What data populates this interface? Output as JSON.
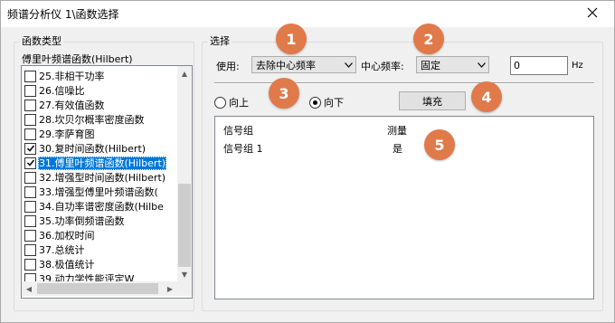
{
  "window": {
    "title": "频谱分析仪 1\\函数选择",
    "close_icon": "close-icon"
  },
  "function_type": {
    "legend": "函数类型",
    "current": "傅里叶频谱函数(Hilbert)",
    "items": [
      {
        "label": "25.非相干功率",
        "checked": false,
        "selected": false
      },
      {
        "label": "26.信噪比",
        "checked": false,
        "selected": false
      },
      {
        "label": "27.有效值函数",
        "checked": false,
        "selected": false
      },
      {
        "label": "28.坎贝尔概率密度函数",
        "checked": false,
        "selected": false
      },
      {
        "label": "29.李萨育图",
        "checked": false,
        "selected": false
      },
      {
        "label": "30.复时间函数(Hilbert)",
        "checked": true,
        "selected": false
      },
      {
        "label": "31.傅里叶频谱函数(Hilbert)",
        "checked": true,
        "selected": true
      },
      {
        "label": "32.增强型时间函数(Hilbert)",
        "checked": false,
        "selected": false
      },
      {
        "label": "33.增强型傅里叶频谱函数(",
        "checked": false,
        "selected": false
      },
      {
        "label": "34.自功率谱密度函数(Hilbe",
        "checked": false,
        "selected": false
      },
      {
        "label": "35.功率倒频谱函数",
        "checked": false,
        "selected": false
      },
      {
        "label": "36.加权时间",
        "checked": false,
        "selected": false
      },
      {
        "label": "37.总统计",
        "checked": false,
        "selected": false
      },
      {
        "label": "38.极值统计",
        "checked": false,
        "selected": false
      },
      {
        "label": "39.动力学性能评定W",
        "checked": false,
        "selected": false
      }
    ]
  },
  "selection": {
    "legend": "选择",
    "use_label": "使用:",
    "use_value": "去除中心频率",
    "center_freq_label": "中心频率:",
    "center_freq_mode": "固定",
    "center_freq_value": "0",
    "unit": "Hz",
    "radio_up": "向上",
    "radio_down": "向下",
    "radio_selected": "down",
    "fill_button": "填充",
    "table": {
      "headers": [
        "信号组",
        "测量"
      ],
      "rows": [
        [
          "信号组 1",
          "是"
        ]
      ]
    }
  },
  "badges": [
    "1",
    "2",
    "3",
    "4",
    "5"
  ],
  "colors": {
    "badge": "#e07a4a",
    "selection": "#0078d7"
  }
}
